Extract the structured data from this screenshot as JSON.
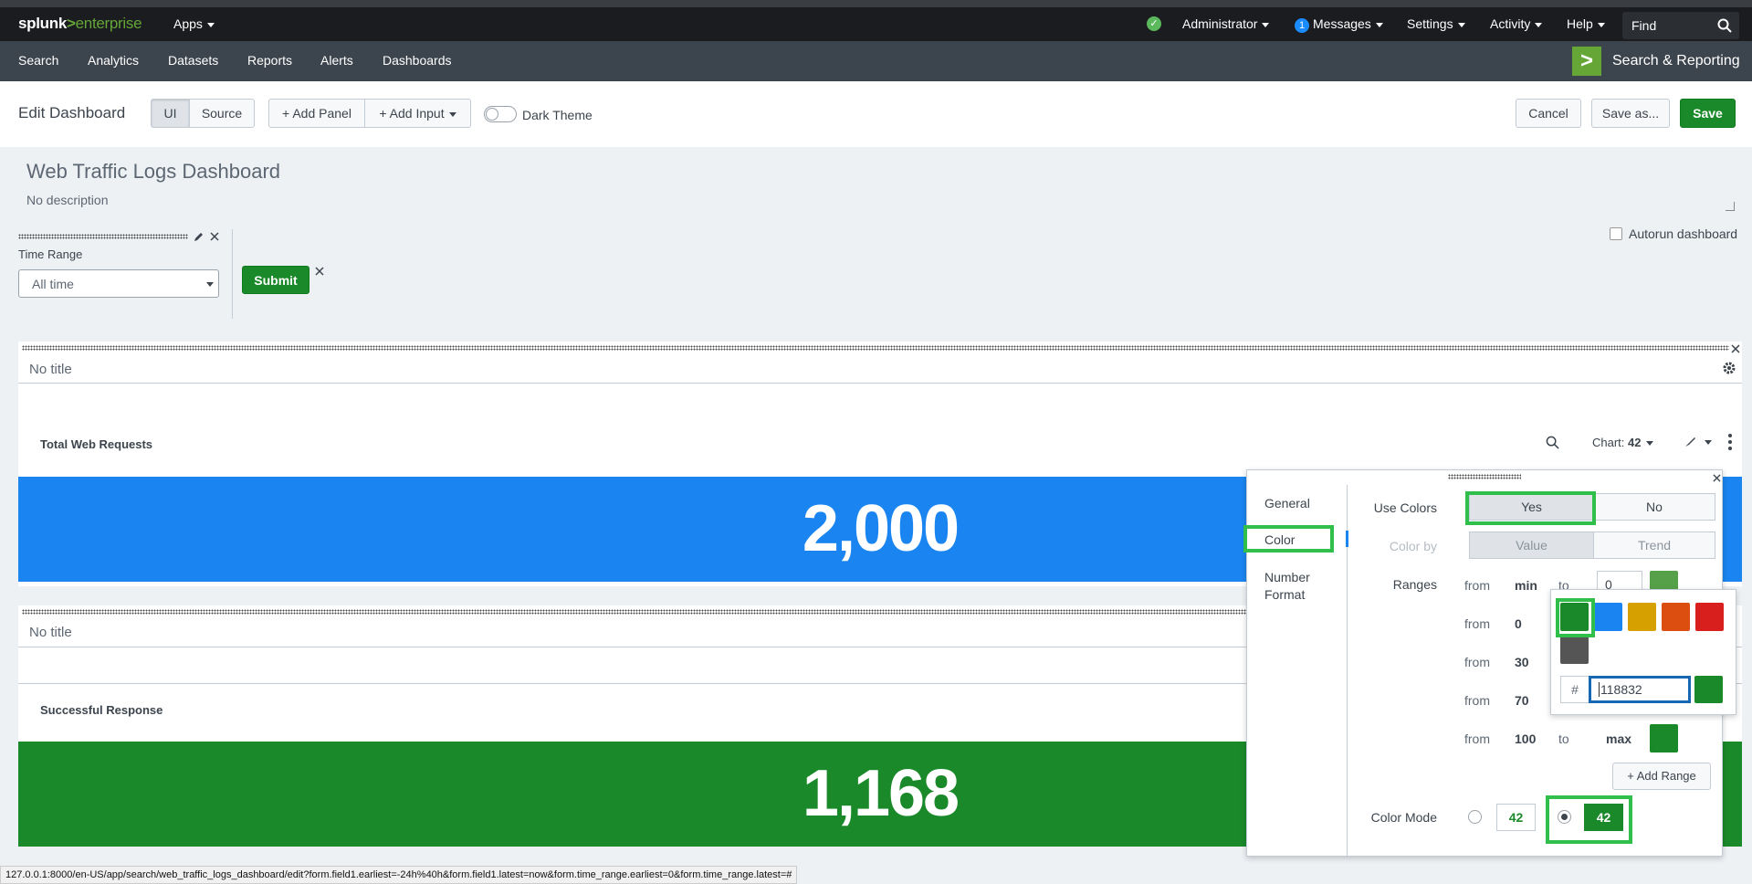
{
  "topbar": {
    "logo_splunk": "splunk",
    "logo_gt": ">",
    "logo_enterprise": "enterprise",
    "apps": "Apps",
    "user": "Administrator",
    "messages_count": "1",
    "messages": "Messages",
    "settings": "Settings",
    "activity": "Activity",
    "help": "Help",
    "find_placeholder": "Find"
  },
  "appbar": {
    "items": [
      "Search",
      "Analytics",
      "Datasets",
      "Reports",
      "Alerts",
      "Dashboards"
    ],
    "app_logo": ">",
    "app_name": "Search & Reporting"
  },
  "editbar": {
    "title": "Edit Dashboard",
    "ui": "UI",
    "source": "Source",
    "add_panel": "+ Add Panel",
    "add_input": "+ Add Input",
    "dark_theme": "Dark Theme",
    "cancel": "Cancel",
    "save_as": "Save as...",
    "save": "Save"
  },
  "dashboard": {
    "title": "Web Traffic Logs Dashboard",
    "description": "No description",
    "autorun": "Autorun dashboard",
    "time_range_label": "Time Range",
    "time_range_value": "All time",
    "submit": "Submit"
  },
  "panels": [
    {
      "title": "No title",
      "single_title": "Total Web Requests",
      "value": "2,000",
      "color": "#1a85f0",
      "chart_label": "Chart:",
      "chart_value": "42"
    },
    {
      "title": "No title",
      "single_title": "Successful Response",
      "value": "1,168",
      "color": "#1a8929"
    }
  ],
  "popover": {
    "tabs": [
      "General",
      "Color",
      "Number Format"
    ],
    "use_colors_label": "Use Colors",
    "use_colors_yes": "Yes",
    "use_colors_no": "No",
    "color_by_label": "Color by",
    "color_by_value": "Value",
    "color_by_trend": "Trend",
    "ranges_label": "Ranges",
    "ranges": [
      {
        "from_label": "from",
        "from": "min",
        "to_label": "to",
        "to": "0",
        "color": "#55a049"
      },
      {
        "from_label": "from",
        "from": "0"
      },
      {
        "from_label": "from",
        "from": "30"
      },
      {
        "from_label": "from",
        "from": "70"
      },
      {
        "from_label": "from",
        "from": "100",
        "to_label": "to",
        "to": "max",
        "color": "#1a8929"
      }
    ],
    "add_range": "+ Add Range",
    "color_mode_label": "Color Mode",
    "mode_value": "42"
  },
  "picker": {
    "swatches": [
      "#1a8929",
      "#1a85f0",
      "#d6a000",
      "#dc4e10",
      "#d91e1e",
      "#555555"
    ],
    "hash": "#",
    "hex_value": "118832",
    "preview": "#1a8929"
  },
  "statusbar": {
    "url": "127.0.0.1:8000/en-US/app/search/web_traffic_logs_dashboard/edit?form.field1.earliest=-24h%40h&form.field1.latest=now&form.time_range.earliest=0&form.time_range.latest=#"
  }
}
